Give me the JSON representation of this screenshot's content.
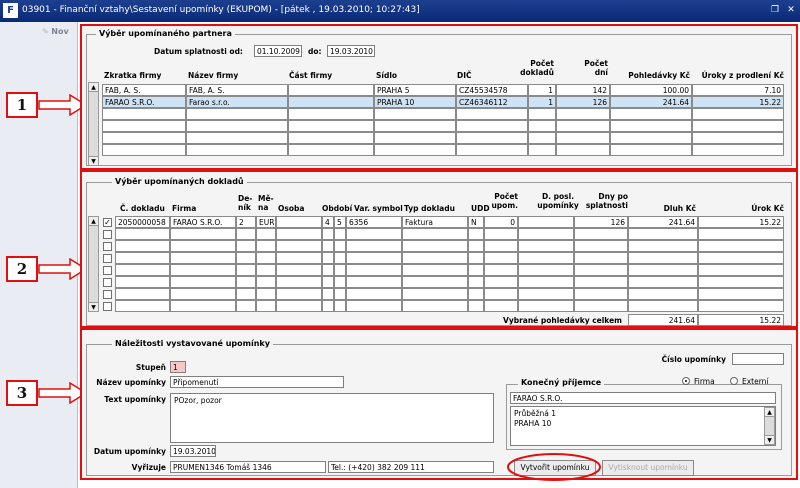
{
  "window": {
    "title": "03901 - Finanční vztahy\\Sestavení upomínky (EKUPOM) - [pátek , 19.03.2010; 10:27:43]",
    "app_icon": "F"
  },
  "toolbar": {
    "new_label": "Nov"
  },
  "callouts": [
    "1",
    "2",
    "3"
  ],
  "partner": {
    "group_title": "Výběr upomínaného partnera",
    "date_from_label": "Datum splatnosti od:",
    "date_from": "01.10.2009",
    "date_to_label": "do:",
    "date_to": "19.03.2010",
    "columns": [
      "Zkratka firmy",
      "Název firmy",
      "Část firmy",
      "Sídlo",
      "DIČ",
      "Počet dokladů",
      "Počet dní",
      "Pohledávky Kč",
      "Úroky z prodlení Kč"
    ],
    "rows": [
      [
        "FAB, A. S.",
        "FAB, A. S.",
        "",
        "PRAHA 5",
        "CZ45534578",
        "1",
        "142",
        "100.00",
        "7.10"
      ],
      [
        "FARAO S.R.O.",
        "Farao s.r.o.",
        "",
        "PRAHA 10",
        "CZ46346112",
        "1",
        "126",
        "241.64",
        "15.22"
      ]
    ]
  },
  "documents": {
    "group_title": "Výběr upomínaných dokladů",
    "columns": [
      "Č. dokladu",
      "Firma",
      "De-ník",
      "Mě-na",
      "Osoba",
      "Období",
      "Var. symbol",
      "Typ dokladu",
      "UDD",
      "Počet upom.",
      "D. posl. upomínky",
      "Dny po splatnosti",
      "Dluh Kč",
      "Úrok Kč"
    ],
    "rows": [
      [
        "2050000058",
        "FARAO S.R.O.",
        "2",
        "EUR",
        "",
        "4",
        "5",
        "6356",
        "Faktura",
        "N",
        "0",
        "",
        "126",
        "241.64",
        "15.22"
      ]
    ],
    "total_label": "Vybrané pohledávky celkem",
    "total_debt": "241.64",
    "total_interest": "15.22"
  },
  "reminder": {
    "group_title": "Náležitosti vystavované upomínky",
    "level_label": "Stupeň",
    "level": "1",
    "number_label": "Číslo upomínky",
    "number": "",
    "name_label": "Název upomínky",
    "name": "Připomenutí",
    "text_label": "Text upomínky",
    "text": "POzor, pozor",
    "date_label": "Datum upomínky",
    "date": "19.03.2010",
    "handler_label": "Vyřizuje",
    "handler": "PRUMEN1346 Tomáš 1346",
    "phone": "Tel.: (+420) 382 209 111",
    "recipient_title": "Konečný příjemce",
    "radio_firm": "Firma",
    "radio_external": "Externí",
    "recipient_name": "FARAO S.R.O.",
    "recipient_address": [
      "Průběžná 1",
      "PRAHA 10"
    ],
    "create_button": "Vytvořit upomínku",
    "send_button": "Vytisknout upomínku"
  },
  "colors": {
    "highlight": "#e01010",
    "selected_row": "#cfe3f7",
    "title_bar": "#0a2a78"
  }
}
